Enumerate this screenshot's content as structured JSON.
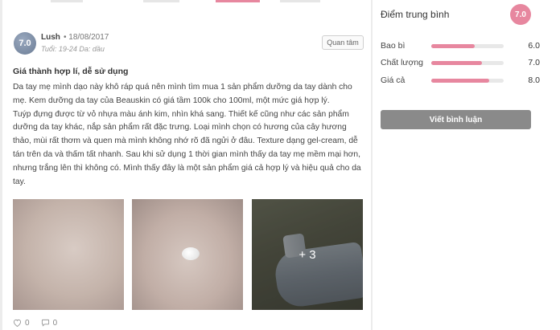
{
  "review": {
    "author": {
      "avatar_score": "7.0",
      "username": "Lush",
      "date": "• 18/08/2017",
      "meta": "Tuổi: 19-24  Da: dầu"
    },
    "follow_label": "Quan tâm",
    "title": "Giá thành hợp lí, dễ sử dụng",
    "body": [
      "Da tay mẹ mình dạo này khô ráp quá nên mình tìm mua 1 sản phẩm dưỡng da tay dành cho mẹ. Kem dưỡng da tay của Beauskin có giá tầm 100k cho 100ml, một mức giá hợp lý.",
      "Tuýp đựng được từ vỏ nhựa màu ánh kim, nhìn khá sang. Thiết kế cũng như các sản phẩm dưỡng da tay khác, nắp sản phẩm rất đặc trưng. Loại mình chọn có hương của cây hương thảo, mùi rất thơm và quen mà mình không nhớ rõ đã ngửi ở đâu. Texture dạng gel-cream, dễ tán trên da và thấm tất nhanh. Sau khi sử dụng 1 thời gian mình thấy da tay mẹ mềm mại hơn, nhưng trắng lên thì không có. Mình thấy đây là một sản phẩm giá cả hợp lý và hiệu quả cho da tay."
    ],
    "more_photos": "+ 3",
    "likes": "0",
    "comments": "0"
  },
  "sidebar": {
    "title": "Điểm trung bình",
    "score": "7.0",
    "ratings": [
      {
        "label": "Bao bì",
        "value": "6.0",
        "fill": 0.6
      },
      {
        "label": "Chất lượng",
        "value": "7.0",
        "fill": 0.7
      },
      {
        "label": "Giá cả",
        "value": "8.0",
        "fill": 0.8
      }
    ],
    "write_review_label": "Viết bình luận"
  },
  "colors": {
    "accent": "#e7879f",
    "button": "#8a8a8a"
  },
  "icons": [
    "heart-icon",
    "comment-icon"
  ]
}
